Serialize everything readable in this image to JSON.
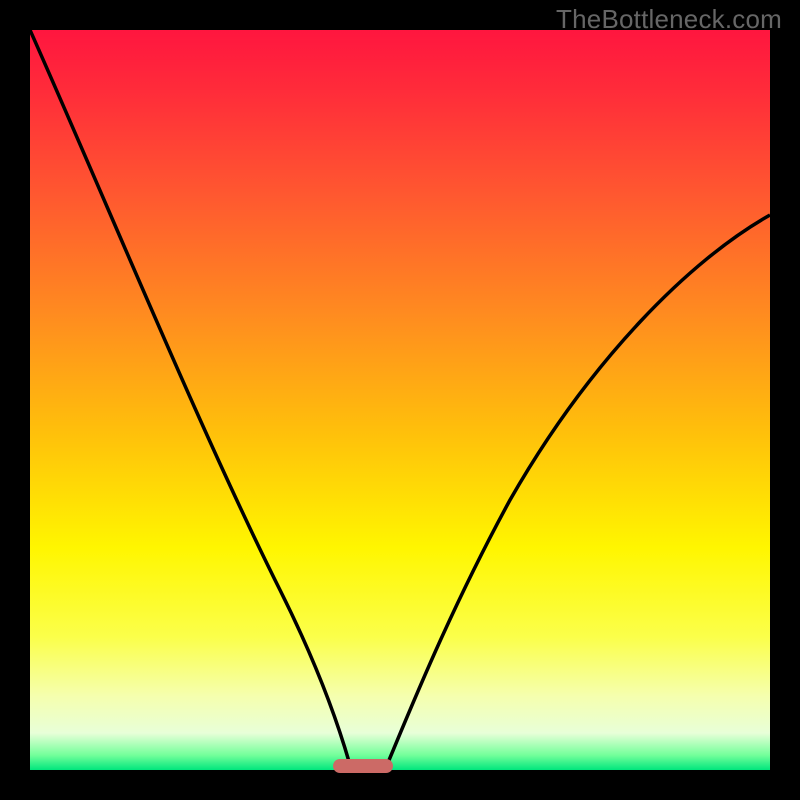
{
  "watermark": {
    "text": "TheBottleneck.com"
  },
  "chart_data": {
    "type": "line",
    "title": "",
    "xlabel": "",
    "ylabel": "",
    "xlim": [
      0,
      100
    ],
    "ylim": [
      0,
      100
    ],
    "grid": false,
    "legend": false,
    "series": [
      {
        "name": "left-curve",
        "x": [
          0,
          6,
          12,
          18,
          24,
          30,
          34,
          38,
          41,
          43
        ],
        "y": [
          100,
          82,
          65,
          50,
          36,
          23,
          14,
          7,
          2,
          0
        ]
      },
      {
        "name": "right-curve",
        "x": [
          48,
          52,
          57,
          63,
          70,
          78,
          86,
          93,
          100
        ],
        "y": [
          0,
          6,
          15,
          27,
          40,
          53,
          63,
          70,
          75
        ]
      }
    ],
    "vertex_x": 45,
    "marker": {
      "x_start": 41,
      "x_end": 49,
      "y": 0
    },
    "gradient_note": "vertical red→orange→yellow→green heat gradient (top=bad, bottom=good)"
  }
}
